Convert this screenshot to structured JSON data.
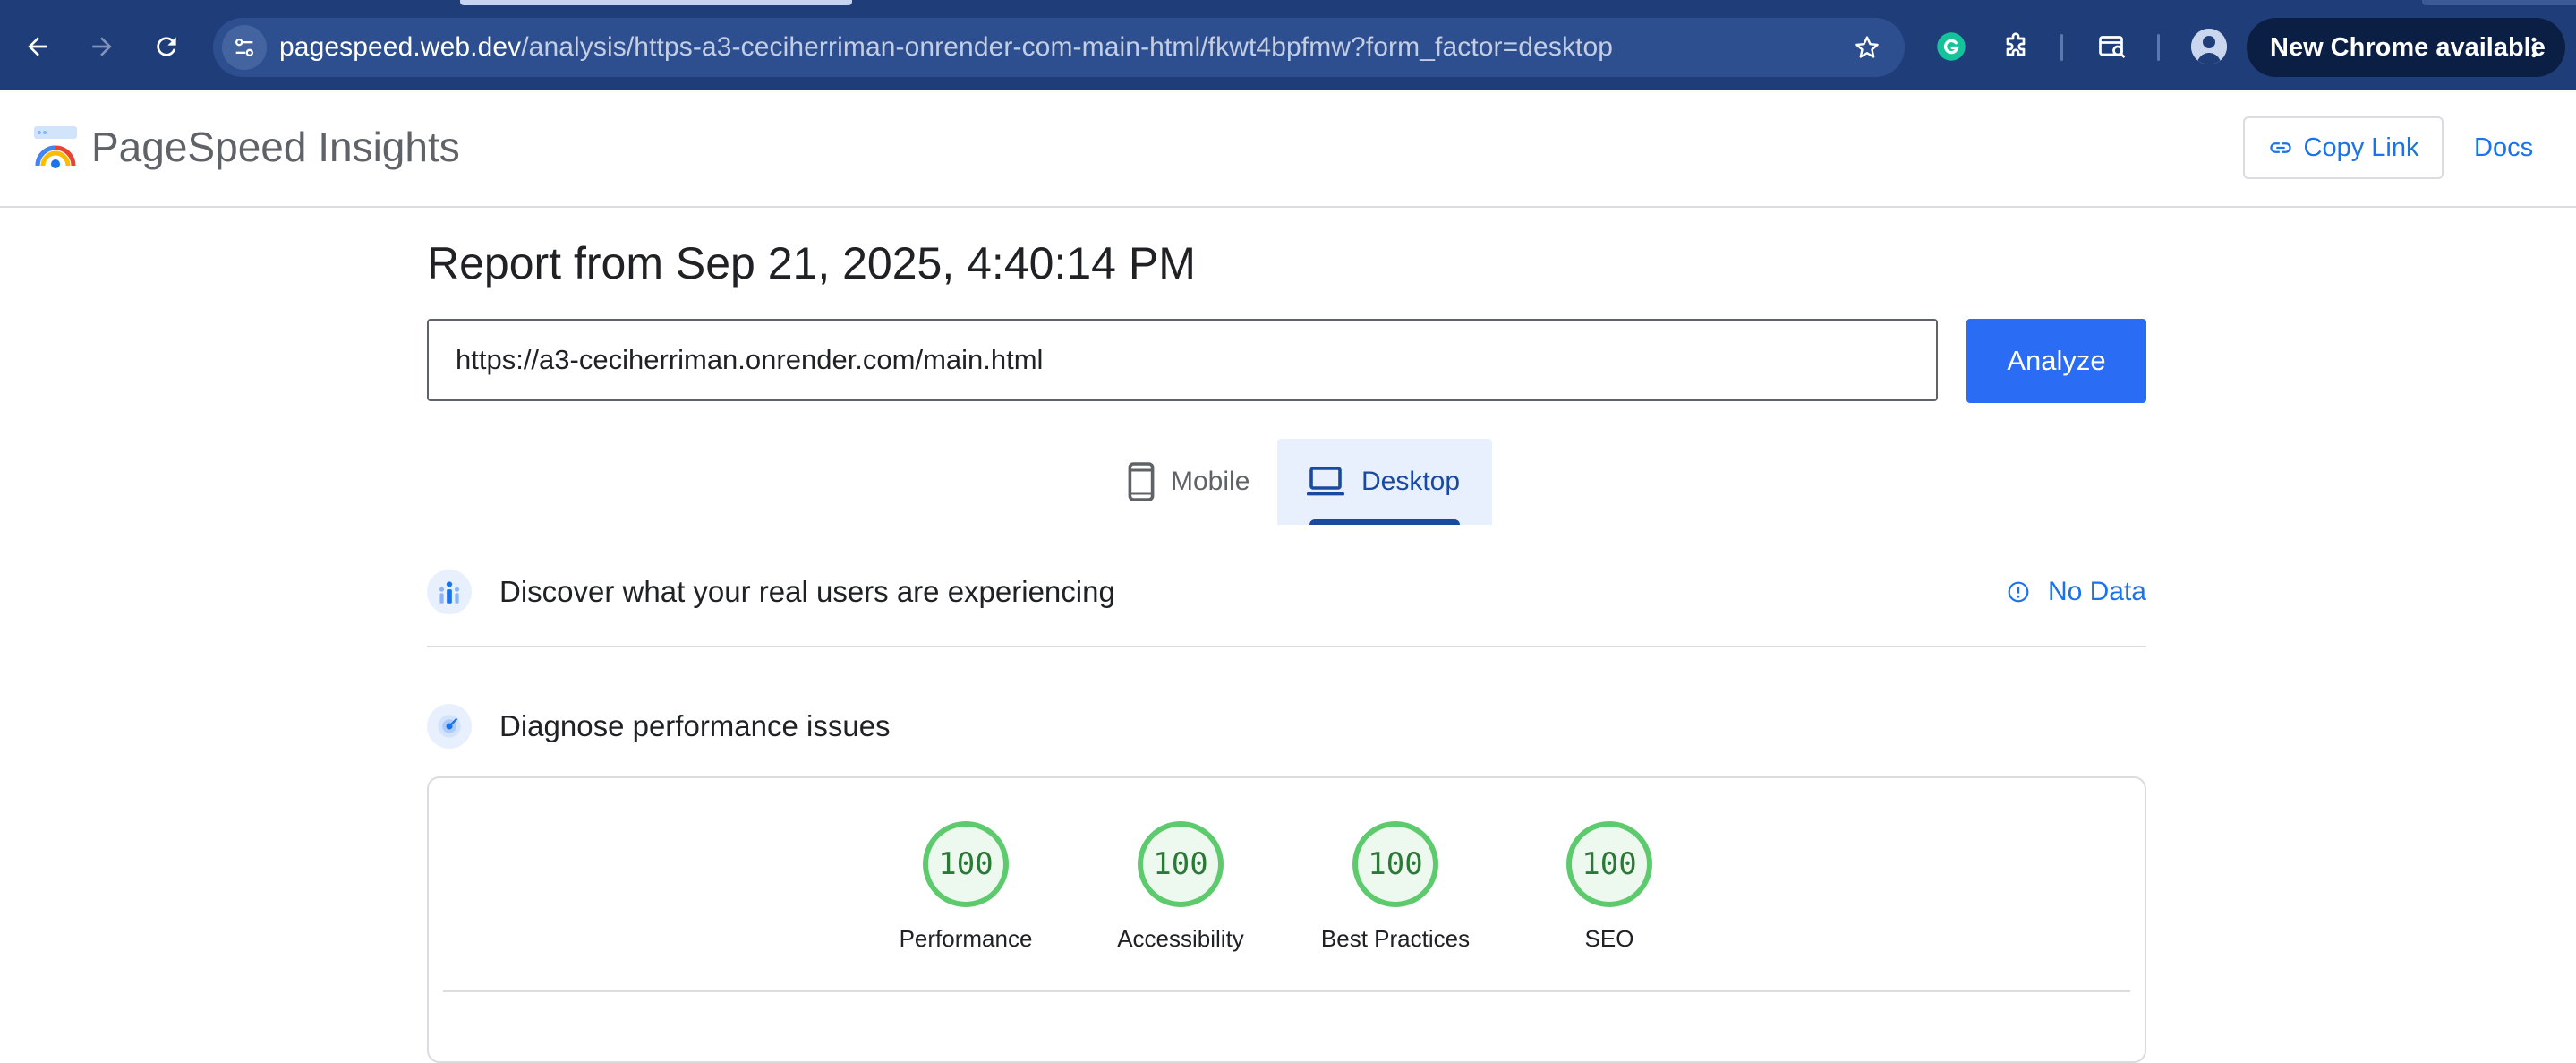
{
  "browser": {
    "url_host": "pagespeed.web.dev",
    "url_path": "/analysis/https-a3-ceciherriman-onrender-com-main-html/fkwt4bpfmw?form_factor=desktop",
    "update_label": "New Chrome available"
  },
  "header": {
    "title": "PageSpeed Insights",
    "copy_link_label": "Copy Link",
    "docs_label": "Docs"
  },
  "report": {
    "title": "Report from Sep 21, 2025, 4:40:14 PM",
    "url_value": "https://a3-ceciherriman.onrender.com/main.html",
    "analyze_label": "Analyze"
  },
  "device_tabs": {
    "mobile": "Mobile",
    "desktop": "Desktop",
    "selected": "desktop"
  },
  "field_data": {
    "heading": "Discover what your real users are experiencing",
    "status": "No Data"
  },
  "diagnose": {
    "heading": "Diagnose performance issues"
  },
  "scores": [
    {
      "label": "Performance",
      "value": "100"
    },
    {
      "label": "Accessibility",
      "value": "100"
    },
    {
      "label": "Best Practices",
      "value": "100"
    },
    {
      "label": "SEO",
      "value": "100"
    }
  ],
  "colors": {
    "chrome_bg": "#1f3d78",
    "accent": "#1a73e8",
    "analyze_bg": "#2a6df4",
    "score_good": "#5dcb6d"
  }
}
